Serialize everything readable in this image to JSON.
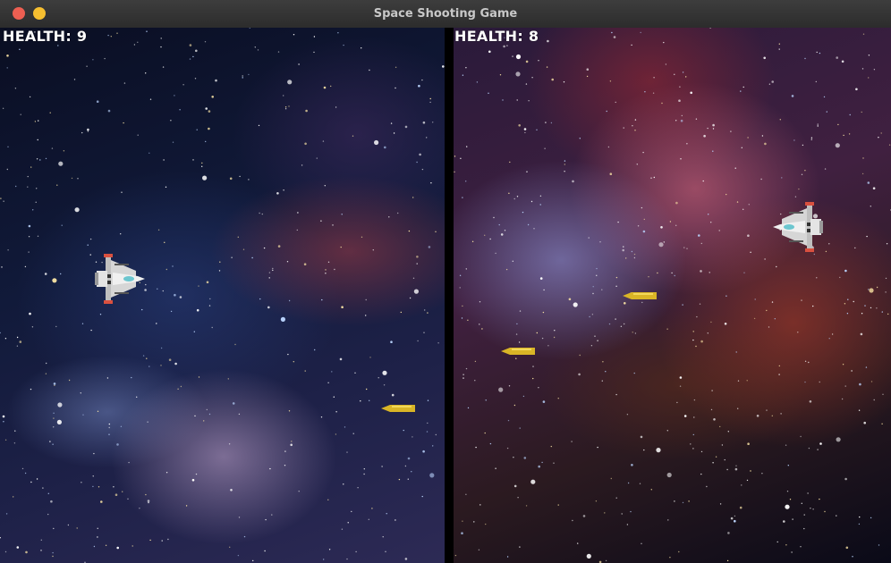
{
  "window": {
    "title": "Space Shooting Game"
  },
  "player_left": {
    "health_label": "HEALTH: 9",
    "health": 9,
    "ship_color": "#c9c9c9",
    "accent": "#d9503f",
    "facing": "right"
  },
  "player_right": {
    "health_label": "HEALTH: 8",
    "health": 8,
    "ship_color": "#c9c9c9",
    "accent": "#d9503f",
    "facing": "left"
  },
  "colors": {
    "bullet": "#d9b526",
    "titlebar": "#333333",
    "close": "#ed5f52",
    "minimize": "#f6bf30"
  },
  "icons": {
    "close": "close-button",
    "minimize": "minimize-button",
    "ship": "spaceship-sprite",
    "bullet": "bullet-sprite"
  }
}
